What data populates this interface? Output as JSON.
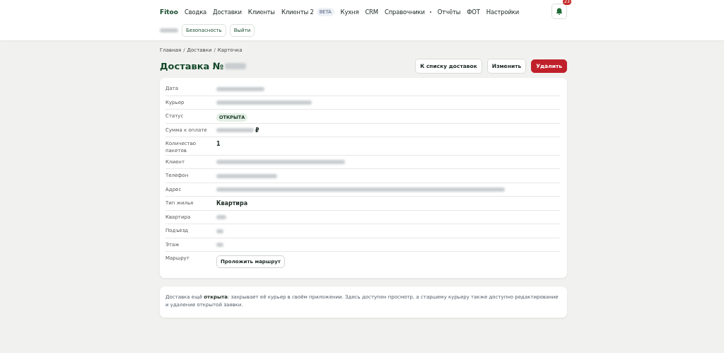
{
  "nav": {
    "brand": "Fitoo",
    "items": [
      {
        "label": "Сводка"
      },
      {
        "label": "Доставки"
      },
      {
        "label": "Клиенты"
      },
      {
        "label": "Клиенты 2",
        "badge": "BETA"
      },
      {
        "label": "Кухня"
      },
      {
        "label": "CRM"
      },
      {
        "label": "Справочники",
        "dropdown": true
      },
      {
        "label": "Отчёты"
      },
      {
        "label": "ФОТ"
      },
      {
        "label": "Настройки"
      }
    ],
    "notifications": "23",
    "user_blurred": true,
    "user_buttons": [
      "Безопасность",
      "Выйти"
    ]
  },
  "breadcrumbs": [
    "Главная",
    "Доставки",
    "Карточка"
  ],
  "breadcrumb_separators": [
    "/",
    "/"
  ],
  "page": {
    "title": "Доставка №",
    "title_blurred": true,
    "actions": [
      {
        "label": "К списку доставок",
        "kind": "outline"
      },
      {
        "label": "Изменить",
        "kind": "outline"
      },
      {
        "label": "Удалить",
        "kind": "danger"
      }
    ]
  },
  "fields": [
    {
      "label": "Дата",
      "kind": "blurred"
    },
    {
      "label": "Курьер",
      "kind": "blurred"
    },
    {
      "label": "Статус",
      "kind": "status",
      "value": "ОТКРЫТА"
    },
    {
      "label": "Сумма к оплате",
      "kind": "blurred",
      "suffix": "₽"
    },
    {
      "label": "Количество пакетов",
      "kind": "text",
      "value": "1"
    },
    {
      "label": "Клиент",
      "kind": "blurred"
    },
    {
      "label": "Телефон",
      "kind": "blurred"
    },
    {
      "label": "Адрес",
      "kind": "blurred"
    },
    {
      "label": "Тип жилья",
      "kind": "bold",
      "value": "Квартира"
    },
    {
      "label": "Квартира",
      "kind": "blurred"
    },
    {
      "label": "Подъезд",
      "kind": "blurred"
    },
    {
      "label": "Этаж",
      "kind": "blurred"
    },
    {
      "label": "Маршрут",
      "kind": "button",
      "value": "Проложить маршрут"
    }
  ],
  "note": "Доставка ещё **открыта**: закрывает её курьер в своём приложении. Здесь доступен просмотр, а старшему курьеру также доступно редактирование и удаление открытой заявки."
}
